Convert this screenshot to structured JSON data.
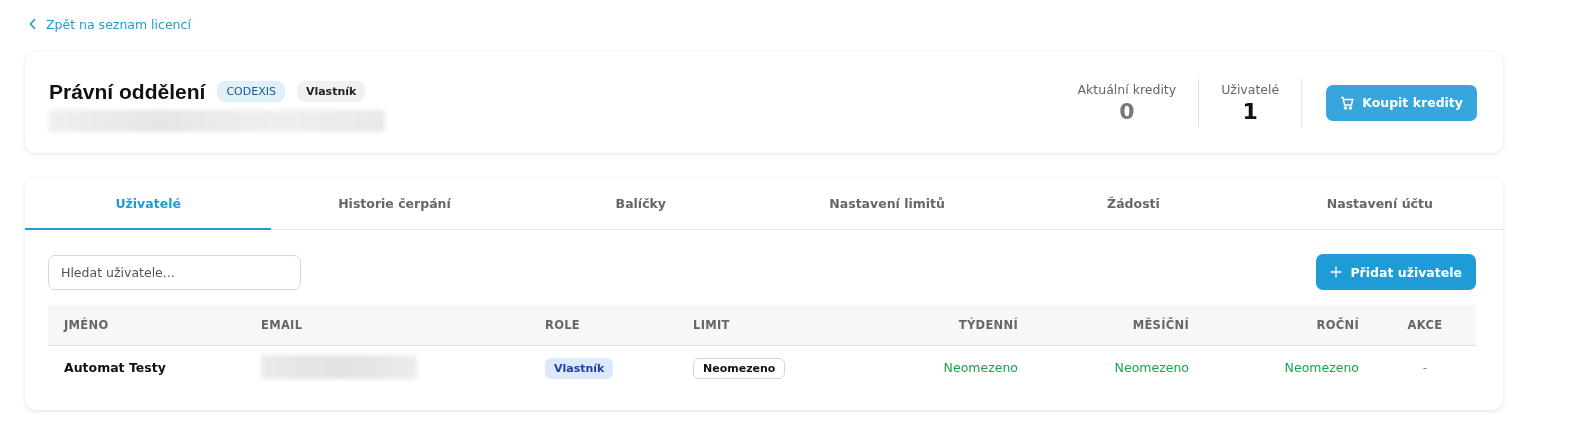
{
  "back_link": "Zpět na seznam licencí",
  "header": {
    "title": "Právní oddělení",
    "badges": [
      {
        "label": "CODEXIS",
        "kind": "product"
      },
      {
        "label": "Vlastník",
        "kind": "role"
      }
    ],
    "stats": [
      {
        "label": "Aktuální kredity",
        "value": "0",
        "muted": true
      },
      {
        "label": "Uživatelé",
        "value": "1",
        "muted": false
      }
    ],
    "buy_button": "Koupit kredity"
  },
  "tabs": [
    {
      "label": "Uživatelé",
      "selected": true
    },
    {
      "label": "Historie čerpání",
      "selected": false
    },
    {
      "label": "Balíčky",
      "selected": false
    },
    {
      "label": "Nastavení limitů",
      "selected": false
    },
    {
      "label": "Žádosti",
      "selected": false
    },
    {
      "label": "Nastavení účtu",
      "selected": false
    }
  ],
  "search": {
    "placeholder": "Hledat uživatele..."
  },
  "add_button": "Přidat uživatele",
  "table": {
    "columns": [
      "JMÉNO",
      "EMAIL",
      "ROLE",
      "LIMIT",
      "TÝDENNÍ",
      "MĚSÍČNÍ",
      "ROČNÍ",
      "AKCE"
    ],
    "rows": [
      {
        "name": "Automat Testy",
        "role": "Vlastník",
        "limit": "Neomezeno",
        "weekly": "Neomezeno",
        "monthly": "Neomezeno",
        "yearly": "Neomezeno",
        "actions": "-"
      }
    ]
  }
}
